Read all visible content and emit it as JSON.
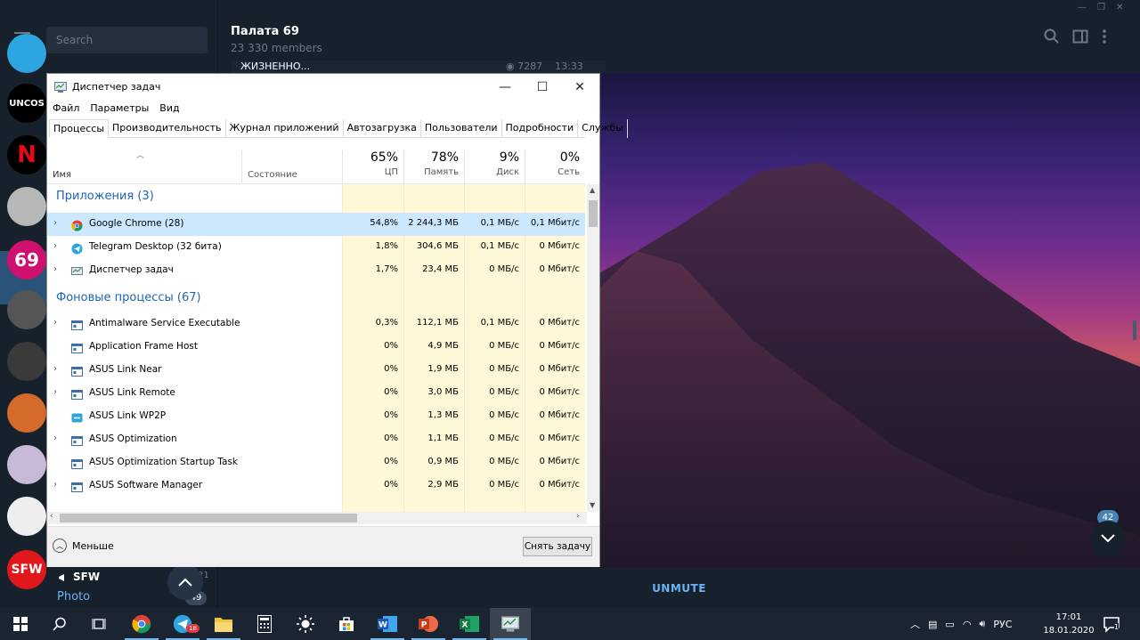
{
  "telegram": {
    "search_placeholder": "Search",
    "chat_title": "Палата 69",
    "chat_members": "23 330 members",
    "msg_stub": "ЖИЗНЕННО...",
    "msg_views": "7287",
    "msg_time": "13:33",
    "unread_count": "42",
    "unmute_label": "UNMUTE",
    "sfw_title": "SFW",
    "sfw_subtitle": "Photo",
    "sfw_badge": "49",
    "avatars": [
      {
        "label": "",
        "color": "#2ca5e0"
      },
      {
        "label": "UNCOS",
        "color": "#000000"
      },
      {
        "label": "N",
        "color": "#000000"
      },
      {
        "label": "",
        "color": "#b7b7b7"
      },
      {
        "label": "69",
        "color": "#d0106f"
      },
      {
        "label": "",
        "color": "#555555"
      },
      {
        "label": "",
        "color": "#3a3a3a"
      },
      {
        "label": "",
        "color": "#d46a2a"
      },
      {
        "label": "",
        "color": "#c8b9d8"
      },
      {
        "label": "",
        "color": "#eeeeee"
      },
      {
        "label": "SFW",
        "color": "#e0181b"
      }
    ]
  },
  "taskmanager": {
    "title": "Диспетчер задач",
    "menu": [
      "Файл",
      "Параметры",
      "Вид"
    ],
    "tabs": [
      "Процессы",
      "Производительность",
      "Журнал приложений",
      "Автозагрузка",
      "Пользователи",
      "Подробности",
      "Службы"
    ],
    "columns": {
      "name": "Имя",
      "status": "Состояние",
      "cpu_pct": "65%",
      "cpu_label": "ЦП",
      "mem_pct": "78%",
      "mem_label": "Память",
      "disk_pct": "9%",
      "disk_label": "Диск",
      "net_pct": "0%",
      "net_label": "Сеть"
    },
    "groups": {
      "apps": "Приложения (3)",
      "background": "Фоновые процессы (67)"
    },
    "apps": [
      {
        "name": "Google Chrome (28)",
        "icon": "chrome-icon",
        "cpu": "54,8%",
        "mem": "2 244,3 МБ",
        "disk": "0,1 МБ/с",
        "net": "0,1 Мбит/с",
        "expand": true
      },
      {
        "name": "Telegram Desktop (32 бита)",
        "icon": "telegram-icon",
        "cpu": "1,8%",
        "mem": "304,6 МБ",
        "disk": "0,1 МБ/с",
        "net": "0 Мбит/с",
        "expand": true
      },
      {
        "name": "Диспетчер задач",
        "icon": "taskmanager-icon",
        "cpu": "1,7%",
        "mem": "23,4 МБ",
        "disk": "0 МБ/с",
        "net": "0 Мбит/с",
        "expand": true
      }
    ],
    "background": [
      {
        "name": "Antimalware Service Executable",
        "icon": "service-icon",
        "cpu": "0,3%",
        "mem": "112,1 МБ",
        "disk": "0,1 МБ/с",
        "net": "0 Мбит/с",
        "expand": true
      },
      {
        "name": "Application Frame Host",
        "icon": "service-icon",
        "cpu": "0%",
        "mem": "4,9 МБ",
        "disk": "0 МБ/с",
        "net": "0 Мбит/с",
        "expand": false
      },
      {
        "name": "ASUS Link Near",
        "icon": "service-icon",
        "cpu": "0%",
        "mem": "1,9 МБ",
        "disk": "0 МБ/с",
        "net": "0 Мбит/с",
        "expand": true
      },
      {
        "name": "ASUS Link Remote",
        "icon": "service-icon",
        "cpu": "0%",
        "mem": "3,0 МБ",
        "disk": "0 МБ/с",
        "net": "0 Мбит/с",
        "expand": true
      },
      {
        "name": "ASUS Link WP2P",
        "icon": "link-icon",
        "cpu": "0%",
        "mem": "1,3 МБ",
        "disk": "0 МБ/с",
        "net": "0 Мбит/с",
        "expand": false
      },
      {
        "name": "ASUS Optimization",
        "icon": "service-icon",
        "cpu": "0%",
        "mem": "1,1 МБ",
        "disk": "0 МБ/с",
        "net": "0 Мбит/с",
        "expand": true
      },
      {
        "name": "ASUS Optimization Startup Task",
        "icon": "service-icon",
        "cpu": "0%",
        "mem": "0,9 МБ",
        "disk": "0 МБ/с",
        "net": "0 Мбит/с",
        "expand": false
      },
      {
        "name": "ASUS Software Manager",
        "icon": "service-icon",
        "cpu": "0%",
        "mem": "2,9 МБ",
        "disk": "0 МБ/с",
        "net": "0 Мбит/с",
        "expand": true
      }
    ],
    "fewer_label": "Меньше",
    "end_task_label": "Снять задачу"
  },
  "taskbar": {
    "apps": [
      "start-icon",
      "search-icon",
      "task-view-icon",
      "chrome-icon",
      "telegram-icon",
      "file-explorer-icon",
      "calculator-icon",
      "brightness-icon",
      "store-icon",
      "word-icon",
      "powerpoint-icon",
      "excel-icon",
      "taskmanager-icon"
    ],
    "active_app": "taskmanager-icon",
    "telegram_badge": "18",
    "language": "РУС",
    "time": "17:01",
    "date": "18.01.2020",
    "notif_count": "1"
  }
}
